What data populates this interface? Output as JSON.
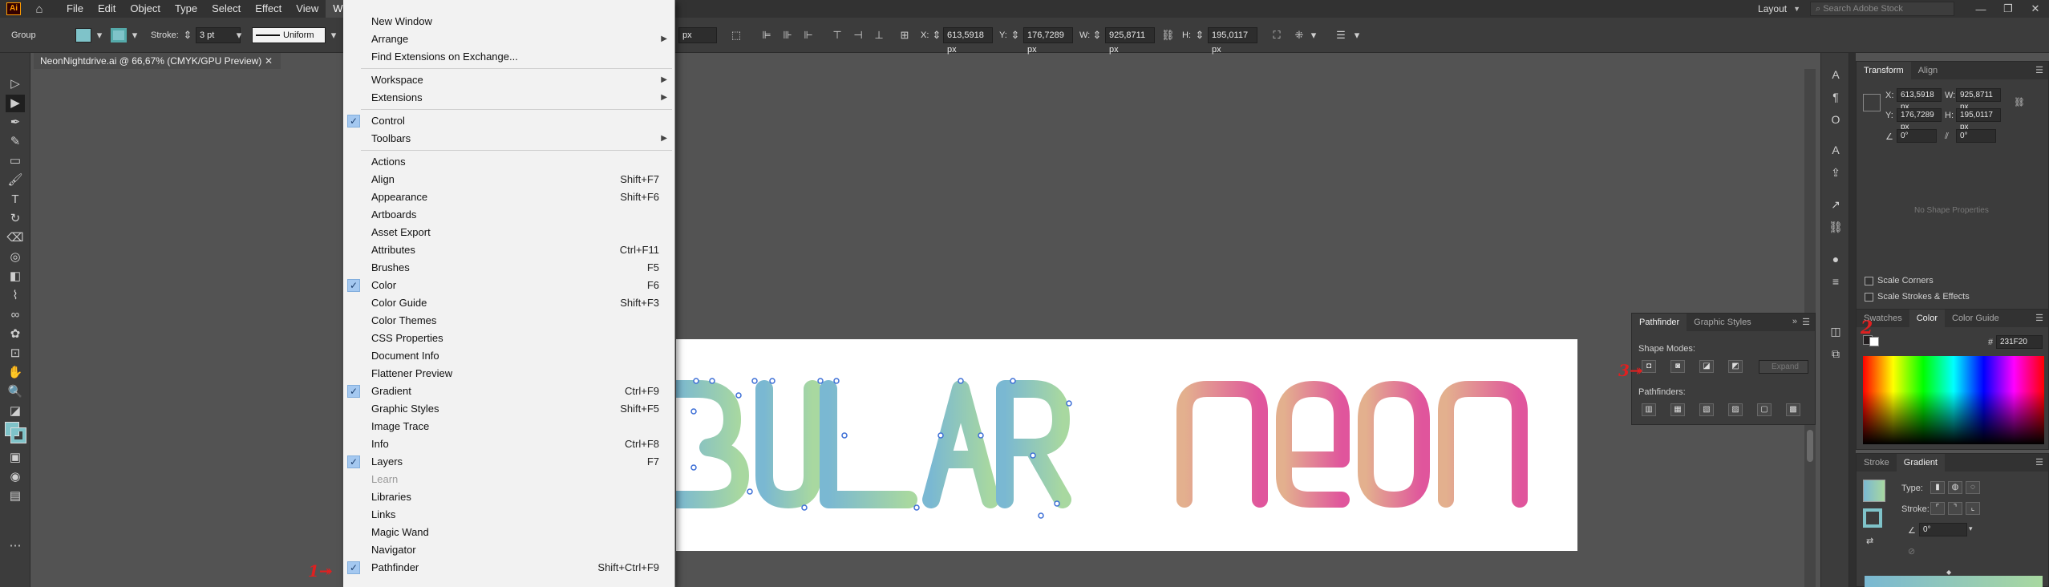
{
  "menubar": {
    "logo": "Ai",
    "items": [
      "File",
      "Edit",
      "Object",
      "Type",
      "Select",
      "Effect",
      "View",
      "Window"
    ],
    "layout_label": "Layout",
    "stock_search_placeholder": "Search Adobe Stock"
  },
  "control_bar": {
    "selection_label": "Group",
    "stroke_label": "Stroke:",
    "stroke_weight": "3 pt",
    "brush_profile": "Uniform",
    "x_label": "X:",
    "x_value": "613,5918 px",
    "y_label": "Y:",
    "y_value": "176,7289 px",
    "w_label": "W:",
    "w_value": "925,8711 px",
    "h_label": "H:",
    "h_value": "195,0117 px",
    "unit_field": "px"
  },
  "document_tab": {
    "title": "NeonNightdrive.ai @ 66,67% (CMYK/GPU Preview)"
  },
  "artwork": {
    "left_word": "BULAR",
    "right_word": "neon",
    "colors": {
      "left_gradient_start": "#7ab8d2",
      "left_gradient_end": "#a8d8a0",
      "right_gradient_start": "#e3b08e",
      "right_gradient_end": "#e0559c",
      "anchor": "#3d6fd6"
    }
  },
  "window_menu": {
    "items": [
      {
        "label": "New Window",
        "shortcut": "",
        "checked": false,
        "submenu": false
      },
      {
        "label": "Arrange",
        "shortcut": "",
        "checked": false,
        "submenu": true
      },
      {
        "label": "Find Extensions on Exchange...",
        "shortcut": "",
        "checked": false,
        "submenu": false
      },
      {
        "label": "Workspace",
        "shortcut": "",
        "checked": false,
        "submenu": true
      },
      {
        "label": "Extensions",
        "shortcut": "",
        "checked": false,
        "submenu": true
      },
      {
        "label": "Control",
        "shortcut": "",
        "checked": true,
        "submenu": false
      },
      {
        "label": "Toolbars",
        "shortcut": "",
        "checked": false,
        "submenu": true
      },
      {
        "label": "Actions",
        "shortcut": "",
        "checked": false,
        "submenu": false
      },
      {
        "label": "Align",
        "shortcut": "Shift+F7",
        "checked": false,
        "submenu": false
      },
      {
        "label": "Appearance",
        "shortcut": "Shift+F6",
        "checked": false,
        "submenu": false
      },
      {
        "label": "Artboards",
        "shortcut": "",
        "checked": false,
        "submenu": false
      },
      {
        "label": "Asset Export",
        "shortcut": "",
        "checked": false,
        "submenu": false
      },
      {
        "label": "Attributes",
        "shortcut": "Ctrl+F11",
        "checked": false,
        "submenu": false
      },
      {
        "label": "Brushes",
        "shortcut": "F5",
        "checked": false,
        "submenu": false
      },
      {
        "label": "Color",
        "shortcut": "F6",
        "checked": true,
        "submenu": false
      },
      {
        "label": "Color Guide",
        "shortcut": "Shift+F3",
        "checked": false,
        "submenu": false
      },
      {
        "label": "Color Themes",
        "shortcut": "",
        "checked": false,
        "submenu": false
      },
      {
        "label": "CSS Properties",
        "shortcut": "",
        "checked": false,
        "submenu": false
      },
      {
        "label": "Document Info",
        "shortcut": "",
        "checked": false,
        "submenu": false
      },
      {
        "label": "Flattener Preview",
        "shortcut": "",
        "checked": false,
        "submenu": false
      },
      {
        "label": "Gradient",
        "shortcut": "Ctrl+F9",
        "checked": true,
        "submenu": false
      },
      {
        "label": "Graphic Styles",
        "shortcut": "Shift+F5",
        "checked": false,
        "submenu": false
      },
      {
        "label": "Image Trace",
        "shortcut": "",
        "checked": false,
        "submenu": false
      },
      {
        "label": "Info",
        "shortcut": "Ctrl+F8",
        "checked": false,
        "submenu": false
      },
      {
        "label": "Layers",
        "shortcut": "F7",
        "checked": true,
        "submenu": false
      },
      {
        "label": "Learn",
        "shortcut": "",
        "checked": false,
        "submenu": false,
        "disabled": true
      },
      {
        "label": "Libraries",
        "shortcut": "",
        "checked": false,
        "submenu": false
      },
      {
        "label": "Links",
        "shortcut": "",
        "checked": false,
        "submenu": false
      },
      {
        "label": "Magic Wand",
        "shortcut": "",
        "checked": false,
        "submenu": false
      },
      {
        "label": "Navigator",
        "shortcut": "",
        "checked": false,
        "submenu": false
      },
      {
        "label": "Pathfinder",
        "shortcut": "Shift+Ctrl+F9",
        "checked": true,
        "submenu": false
      }
    ]
  },
  "pathfinder_panel": {
    "tabs": [
      "Pathfinder",
      "Graphic Styles"
    ],
    "shape_modes_label": "Shape Modes:",
    "expand_label": "Expand",
    "pathfinders_label": "Pathfinders:"
  },
  "transform_panel": {
    "tabs": [
      "Transform",
      "Align"
    ],
    "x_label": "X:",
    "x_value": "613,5918 px",
    "y_label": "Y:",
    "y_value": "176,7289 px",
    "w_label": "W:",
    "w_value": "925,8711 px",
    "h_label": "H:",
    "h_value": "195,0117 px",
    "rotate_value": "0°",
    "shear_value": "0°",
    "no_shape_text": "No Shape Properties",
    "scale_corners": "Scale Corners",
    "scale_strokes": "Scale Strokes & Effects"
  },
  "color_panel": {
    "tabs": [
      "Swatches",
      "Color",
      "Color Guide"
    ],
    "hex_label": "#",
    "hex_value": "231F20"
  },
  "gradient_panel": {
    "tabs": [
      "Stroke",
      "Gradient"
    ],
    "type_label": "Type:",
    "stroke_label": "Stroke:",
    "angle_value": "0°"
  },
  "annotations": {
    "one": "1",
    "two": "2",
    "three": "3"
  }
}
